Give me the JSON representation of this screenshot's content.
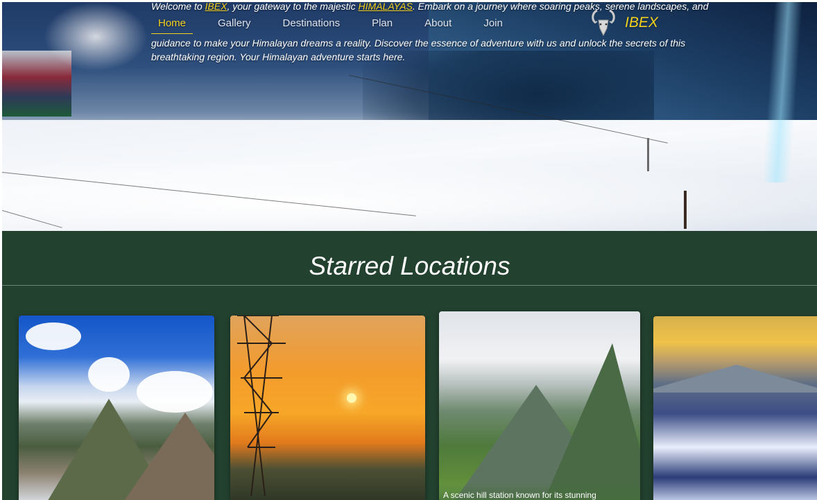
{
  "hero": {
    "intro_prefix": "Welcome to ",
    "brand_inline": "IBEX",
    "intro_mid": ", your gateway to the majestic ",
    "region_inline": "HIMALAYAS",
    "intro_rest_1": ". Embark on a journey where soaring peaks, serene landscapes, and",
    "intro_line_3": "guidance to make your Himalayan dreams a reality. Discover the essence of adventure with us and unlock the secrets of this",
    "intro_line_4": "breathtaking region. Your Himalayan adventure starts here."
  },
  "nav": {
    "items": [
      {
        "label": "Home",
        "active": true
      },
      {
        "label": "Gallery",
        "active": false
      },
      {
        "label": "Destinations",
        "active": false
      },
      {
        "label": "Plan",
        "active": false
      },
      {
        "label": "About",
        "active": false
      },
      {
        "label": "Join",
        "active": false
      }
    ]
  },
  "brand": {
    "name": "IBEX",
    "logo_icon": "ibex-goat-icon"
  },
  "colors": {
    "accent": "#f4d21f",
    "section_bg": "#23412f",
    "text": "#ffffff"
  },
  "section": {
    "title": "Starred Locations"
  },
  "cards": [
    {
      "id": "card-1",
      "caption": ""
    },
    {
      "id": "card-2",
      "caption": ""
    },
    {
      "id": "card-3",
      "caption": "A scenic hill station known for its stunning"
    },
    {
      "id": "card-4",
      "caption": ""
    }
  ]
}
